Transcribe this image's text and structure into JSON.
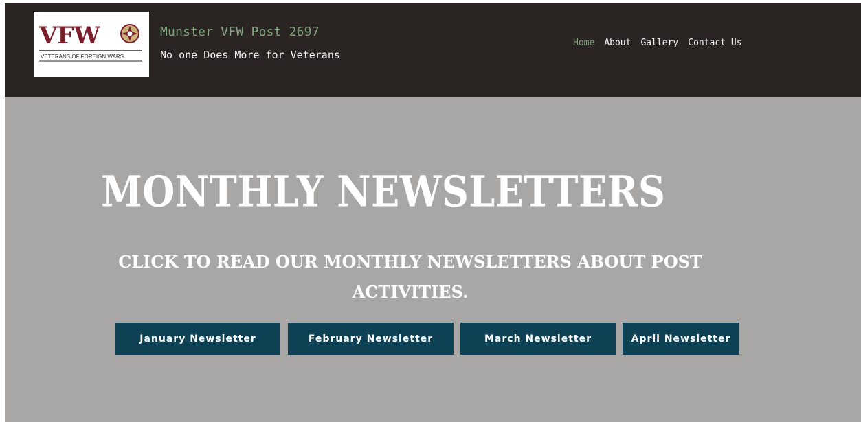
{
  "header": {
    "logo": {
      "wordmark": "VFW",
      "caption": "VETERANS OF FOREIGN WARS",
      "emblem_icon": "vfw-cross-emblem",
      "brand_color": "#7a1f2b"
    },
    "title": "Munster VFW Post 2697",
    "tagline": "No one Does More for Veterans",
    "nav": [
      {
        "label": "Home",
        "active": true
      },
      {
        "label": "About",
        "active": false
      },
      {
        "label": "Gallery",
        "active": false
      },
      {
        "label": "Contact Us",
        "active": false
      }
    ]
  },
  "hero": {
    "title": "Monthly Newsletters",
    "subtitle": "Click to read our monthly newsletters about post activities."
  },
  "newsletters": [
    {
      "label": "January Newsletter"
    },
    {
      "label": "February Newsletter"
    },
    {
      "label": "March Newsletter"
    },
    {
      "label": "April Newsletter"
    }
  ],
  "colors": {
    "header_bg": "#2a2522",
    "hero_bg": "#a8a7a5",
    "accent_green": "#7fa67d",
    "button_bg": "#0d4153"
  }
}
